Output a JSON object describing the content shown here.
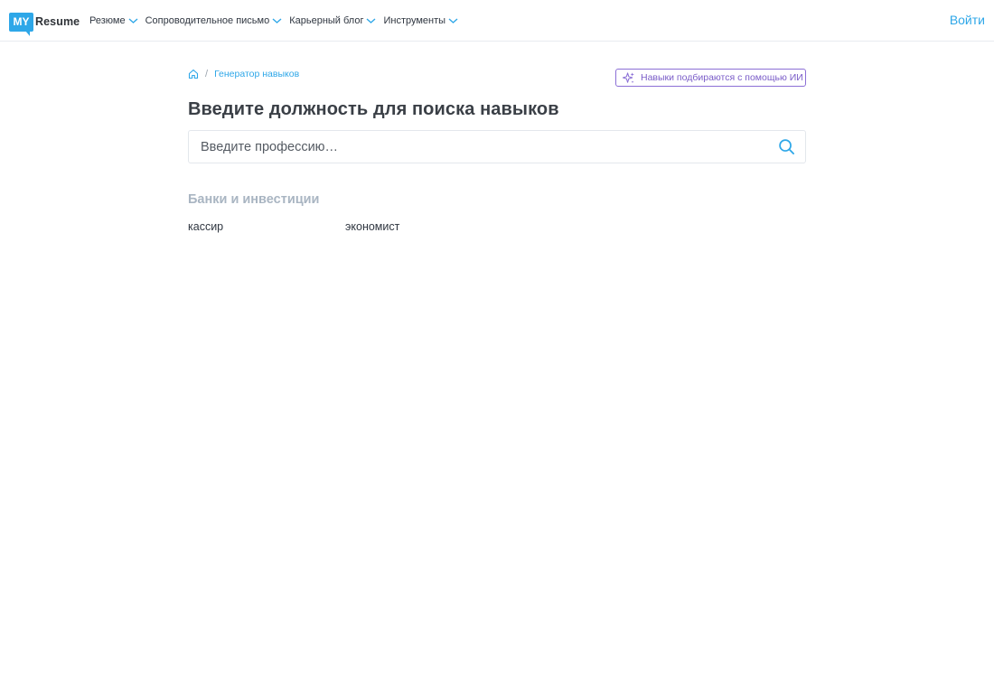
{
  "header": {
    "logo": {
      "box_text": "MY",
      "word": "Resume"
    },
    "nav": [
      {
        "label": "Резюме",
        "icon": "chevron-down-icon"
      },
      {
        "label": "Сопроводительное письмо",
        "icon": "chevron-down-icon"
      },
      {
        "label": "Карьерный блог",
        "icon": "chevron-down-icon"
      },
      {
        "label": "Инструменты",
        "icon": "chevron-down-icon"
      }
    ],
    "login_label": "Войти"
  },
  "breadcrumb": {
    "home_icon": "home-icon",
    "separator": "/",
    "current": "Генератор навыков"
  },
  "ai_badge": {
    "icon": "sparkles-icon",
    "label": "Навыки подбираются с помощью ИИ"
  },
  "page_title": "Введите должность для поиска навыков",
  "search": {
    "placeholder": "Введите профессию…",
    "value": "",
    "icon": "search-icon"
  },
  "category": {
    "title": "Банки и инвестиции",
    "items": [
      "кассир",
      "экономист"
    ]
  },
  "colors": {
    "accent": "#2ea7e8",
    "ai_purple": "#7a5cc8",
    "category_gray": "#a9b5c2",
    "text_dark": "#3a3f46"
  }
}
